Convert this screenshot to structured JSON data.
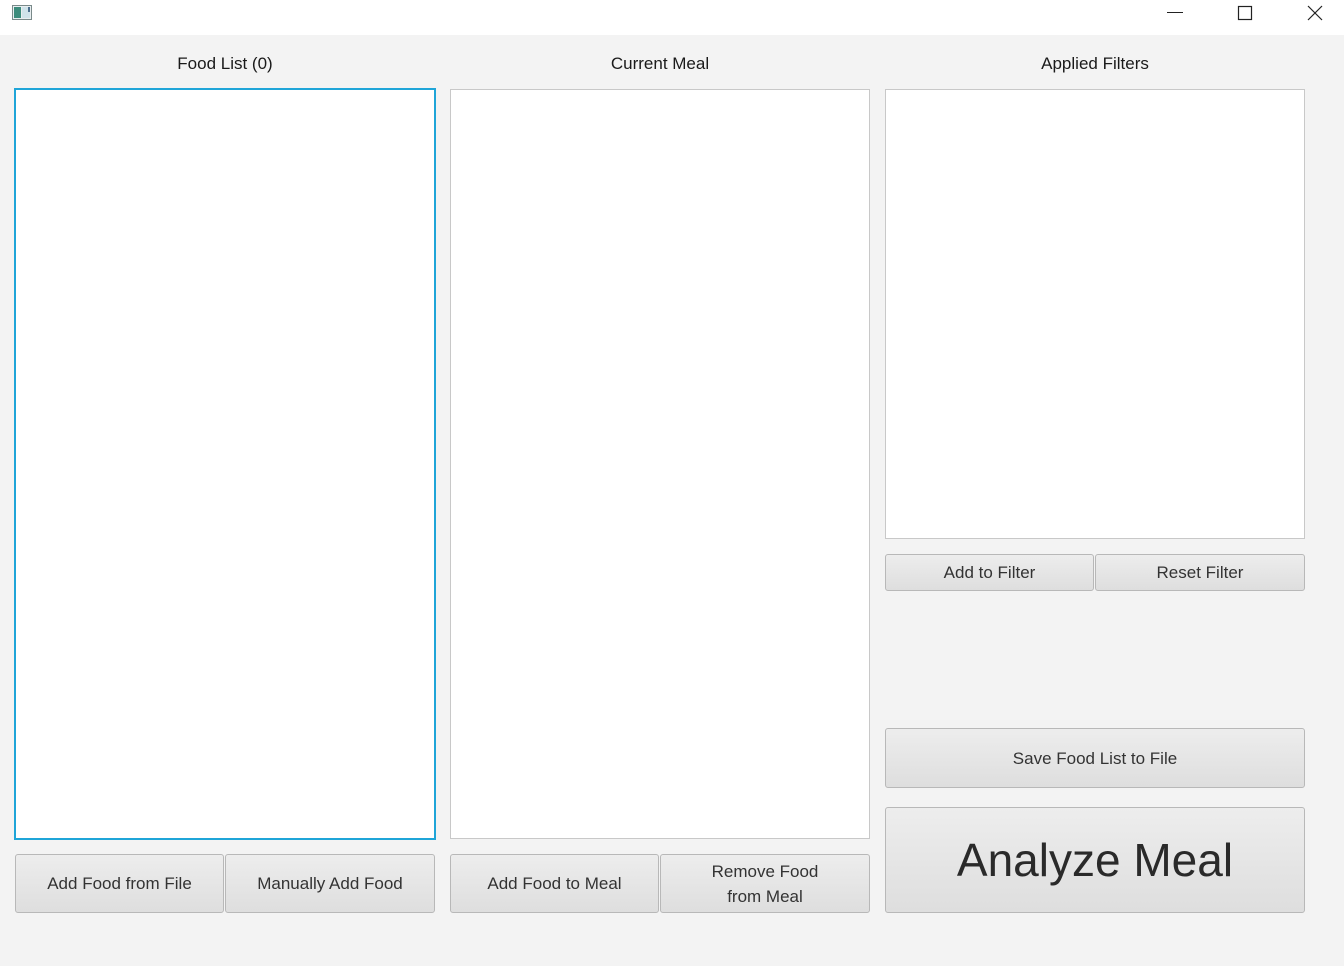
{
  "titlebar": {
    "icon": "app-window-icon",
    "minimize_icon": "minimize-icon",
    "maximize_icon": "maximize-icon",
    "close_icon": "close-icon"
  },
  "columns": {
    "food_list": {
      "title": "Food List (0)"
    },
    "current_meal": {
      "title": "Current Meal"
    },
    "applied_filters": {
      "title": "Applied Filters"
    }
  },
  "buttons": {
    "add_food_from_file": "Add Food from File",
    "manually_add_food": "Manually Add Food",
    "add_food_to_meal": "Add Food to Meal",
    "remove_food_line1": "Remove Food",
    "remove_food_line2": "from Meal",
    "add_to_filter": "Add to Filter",
    "reset_filter": "Reset Filter",
    "save_food_list": "Save Food List to File",
    "analyze_meal": "Analyze Meal"
  },
  "colors": {
    "focus_border": "#1fa5d8",
    "background": "#f3f3f3"
  }
}
